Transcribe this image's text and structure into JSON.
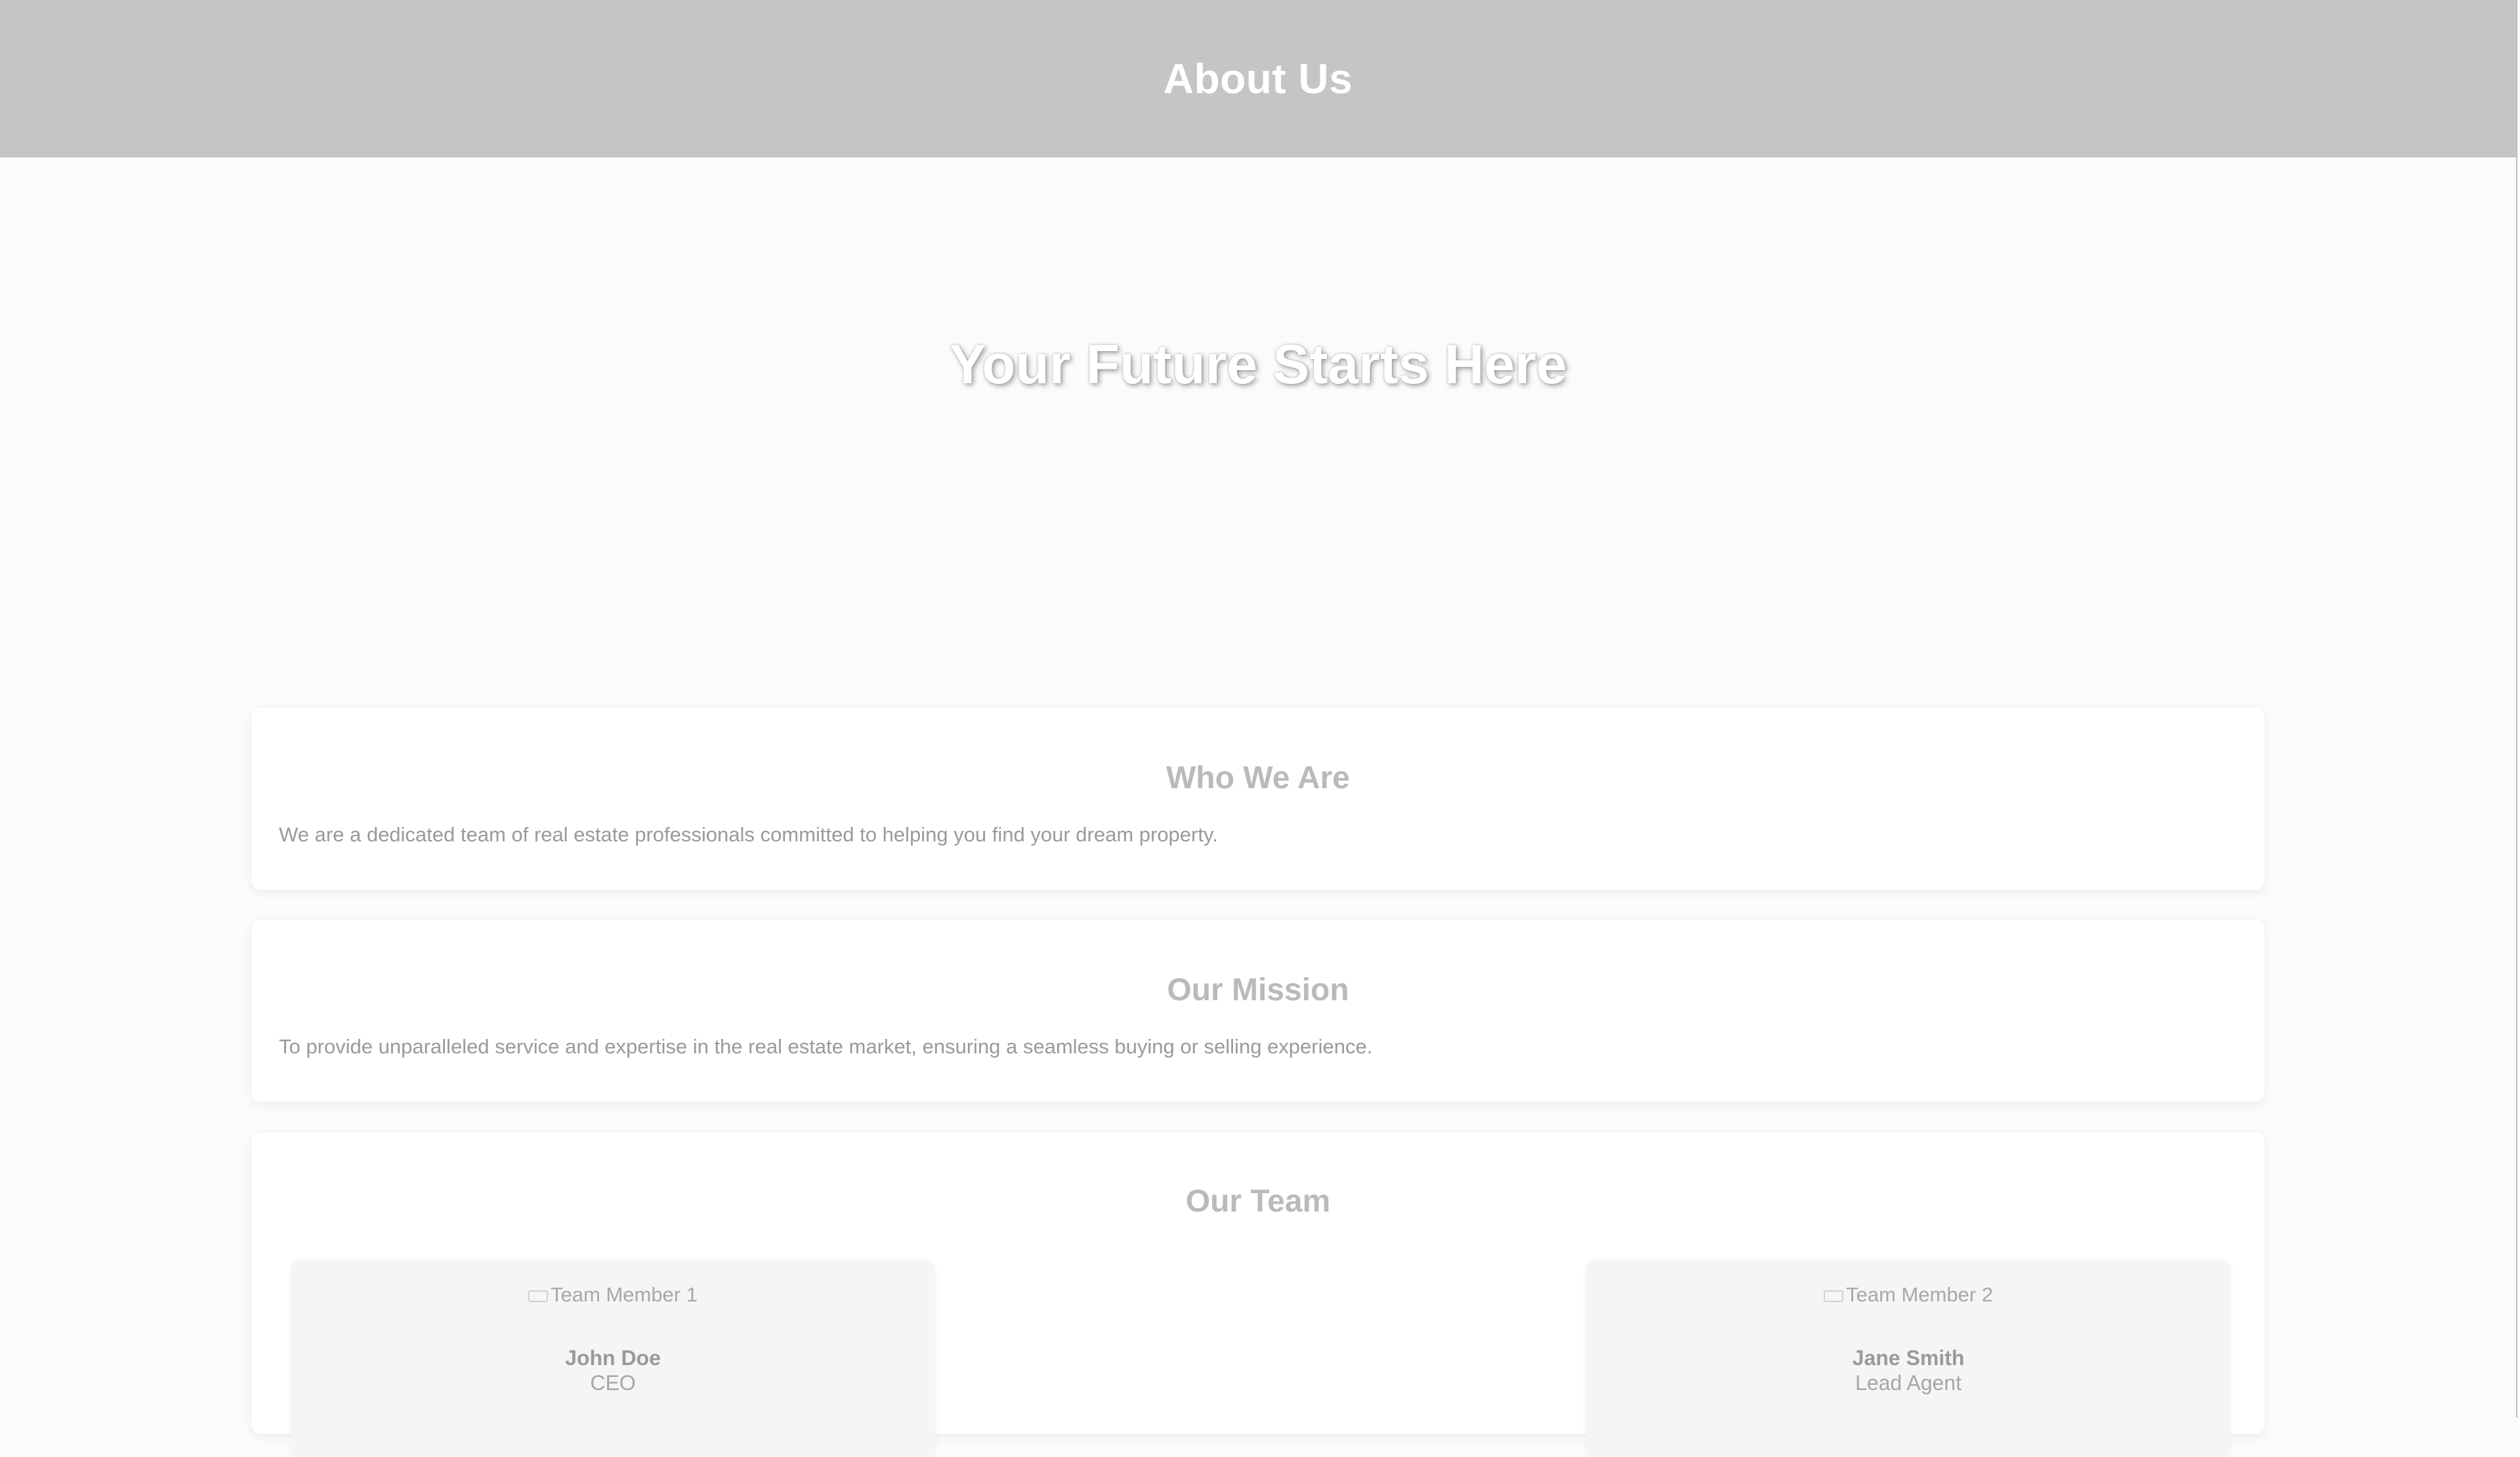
{
  "header": {
    "title": "About Us"
  },
  "hero": {
    "title": "Your Future Starts Here"
  },
  "sections": {
    "who_we_are": {
      "title": "Who We Are",
      "text": "We are a dedicated team of real estate professionals committed to helping you find your dream property."
    },
    "mission": {
      "title": "Our Mission",
      "text": "To provide unparalleled service and expertise in the real estate market, ensuring a seamless buying or selling experience."
    },
    "team": {
      "title": "Our Team",
      "members": [
        {
          "photo_alt": "Team Member 1",
          "name": "John Doe",
          "role": "CEO"
        },
        {
          "photo_alt": "Team Member 2",
          "name": "Jane Smith",
          "role": "Lead Agent"
        }
      ]
    }
  },
  "colors": {
    "header_bg": "#c5c5c5",
    "page_bg": "#fbfbfb",
    "card_bg": "#ffffff",
    "member_card_bg": "#f5f5f5"
  }
}
